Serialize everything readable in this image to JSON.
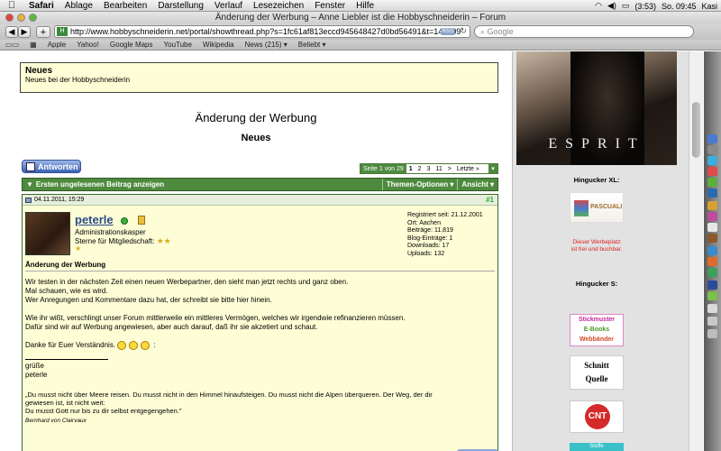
{
  "menubar": {
    "app": "Safari",
    "items": [
      "Ablage",
      "Bearbeiten",
      "Darstellung",
      "Verlauf",
      "Lesezeichen",
      "Fenster",
      "Hilfe"
    ],
    "battery": "(3:53)",
    "clock": "So. 09:45",
    "user": "Kasi"
  },
  "window": {
    "title": "Änderung der Werbung – Anne Liebler ist die Hobbyschneiderin – Forum"
  },
  "toolbar": {
    "url": "http://www.hobbyschneiderin.net/portal/showthread.php?s=1fc61af813eccd945648427d0bd56491&t=146109",
    "rss": "RSS",
    "search_placeholder": "Google"
  },
  "bookmarks": [
    "Apple",
    "Yahoo!",
    "Google Maps",
    "YouTube",
    "Wikipedia",
    "News (215) ▾",
    "Beliebt ▾"
  ],
  "news_box": {
    "title": "Neues",
    "subtitle": "Neues bei der Hobbyschneiderin"
  },
  "thread": {
    "heading": "Änderung der Werbung",
    "subheading": "Neues",
    "reply_label": "Antworten",
    "pager": {
      "info": "Seite 1 von 29",
      "pages": [
        "1",
        "2",
        "3",
        "11",
        ">",
        "Letzte »"
      ],
      "current": "1"
    },
    "first_unread": "Ersten ungelesenen Beitrag anzeigen",
    "tools": "Themen-Optionen ▾",
    "view": "Ansicht ▾"
  },
  "post": {
    "date": "04.11.2011, 15:29",
    "number": "#1",
    "username": "peterle",
    "user_title": "Administrationskasper",
    "stars_label": "Sterne für Mitgliedschaft:",
    "info": [
      "Registriert seit: 21.12.2001",
      "Ort: Aachen",
      "Beiträge: 11.819",
      "Blog-Einträge: 1",
      "Downloads: 17",
      "Uploads: 132"
    ],
    "title": "Änderung der Werbung",
    "para1": "Wir testen in der nächsten Zeit einen neuen Werbepartner, den sieht man jetzt rechts und ganz oben.",
    "para1b": "Mal schauen, wie es wird.",
    "para1c": "Wer Anregungen und Kommentare dazu hat, der schreibt sie bitte hier hinein.",
    "para2": "Wie ihr wißt, verschlingt unser Forum mittlerweile ein mittleres Vermögen, welches wir irgendwie refinanzieren müssen.",
    "para2b": "Dafür sind wir auf Werbung angewiesen, aber auch darauf, daß ihr sie akzetiert und schaut.",
    "para3": "Danke für Euer Verständnis.",
    "para3_tail": ":",
    "greeting": "grüße",
    "sign": "peterle",
    "quote1": "„Du musst nicht über Meere reisen. Du musst nicht in den Himmel hinaufsteigen. Du musst nicht die Alpen überqueren. Der Weg, der dir",
    "quote2": "gewiesen ist, ist nicht weit:",
    "quote3": "Du musst Gott nur bis zu dir selbst entgegengehen.\"",
    "quote_author": "Bernhard von Clairvaux"
  },
  "sidebar": {
    "esprit": "ESPRIT",
    "xl_title": "Hingucker XL:",
    "pascuali": "PASCUALI",
    "free_text1": "Dieser Werbeplatz",
    "free_text2": "ist frei und buchbar.",
    "s_title": "Hingucker S:",
    "stick_1": "Stickmuster",
    "stick_2": "E-Books",
    "stick_3": "Webbänder",
    "schnitt_1": "Schnitt",
    "schnitt_2": "Quelle",
    "cnt": "CNT",
    "stoffe": "Stoffe"
  }
}
